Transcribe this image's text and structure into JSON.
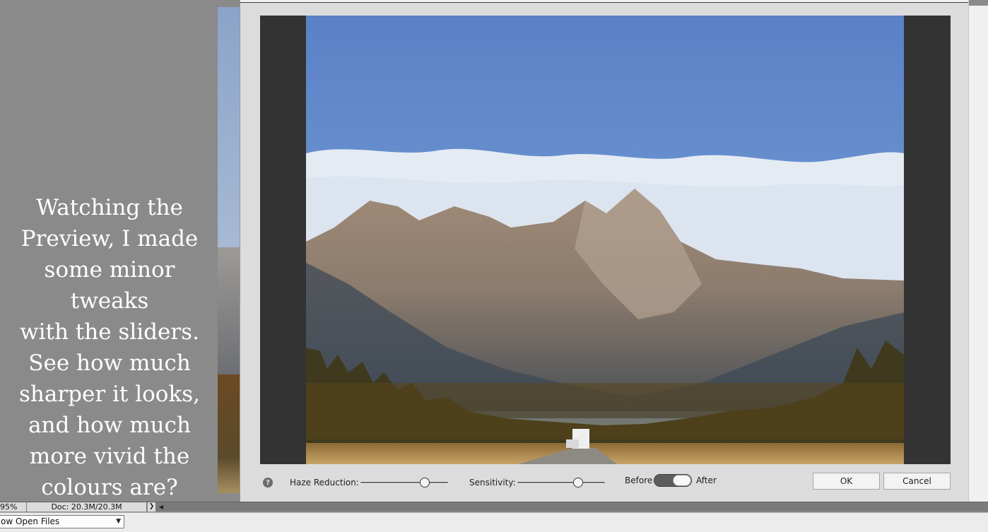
{
  "annotation": {
    "text": "Watching the\nPreview, I made\nsome minor tweaks\nwith the sliders.\nSee how much\nsharper it looks,\nand how much\nmore vivid the\ncolours are?"
  },
  "dialog": {
    "help_icon": "help-icon",
    "help_glyph": "?",
    "haze_reduction": {
      "label": "Haze Reduction:",
      "value": 0.73
    },
    "sensitivity": {
      "label": "Sensitivity:",
      "value": 0.69
    },
    "before_label": "Before",
    "after_label": "After",
    "toggle_state": "after",
    "ok_label": "OK",
    "cancel_label": "Cancel"
  },
  "statusbar": {
    "zoom": "95%",
    "doc": "Doc: 20.3M/20.3M",
    "arrow": "❯",
    "scroll": "◀"
  },
  "binbar": {
    "select_value": "ow Open Files",
    "caret": "▼"
  },
  "colors": {
    "workspace": "#8a8a8a",
    "dialog_bg": "#dcdcdc",
    "preview_bg": "#333333"
  }
}
